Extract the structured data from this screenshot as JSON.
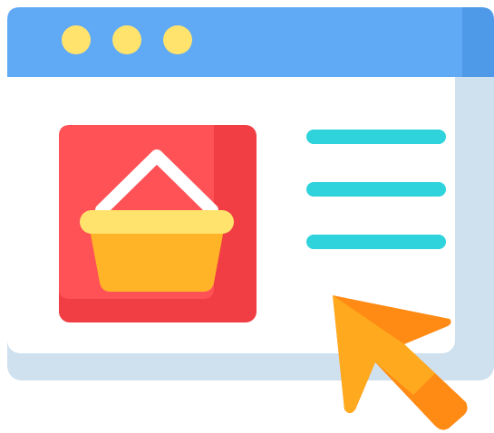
{
  "icon": "online-shopping-browser-icon",
  "colors": {
    "titlebar": "#60A9F4",
    "titlebar_shade": "#4E9AE8",
    "window_shadow": "#CFE0EE",
    "window_body": "#FFFFFF",
    "traffic_dot": "#FFE36C",
    "product_tile": "#FF5257",
    "product_tile_shade": "#F03E44",
    "basket_handle": "#FFFFFF",
    "basket_rim": "#FFE36C",
    "basket_body": "#FFB427",
    "text_lines": "#2ED3DB",
    "cursor": "#FFA91E",
    "cursor_shade": "#FF8A14"
  },
  "window": {
    "dots": [
      "dot-1",
      "dot-2",
      "dot-3"
    ],
    "text_lines": [
      "line-1",
      "line-2",
      "line-3"
    ]
  },
  "elements": {
    "product_image": "shopping-basket-icon",
    "pointer": "cursor-arrow-icon"
  }
}
